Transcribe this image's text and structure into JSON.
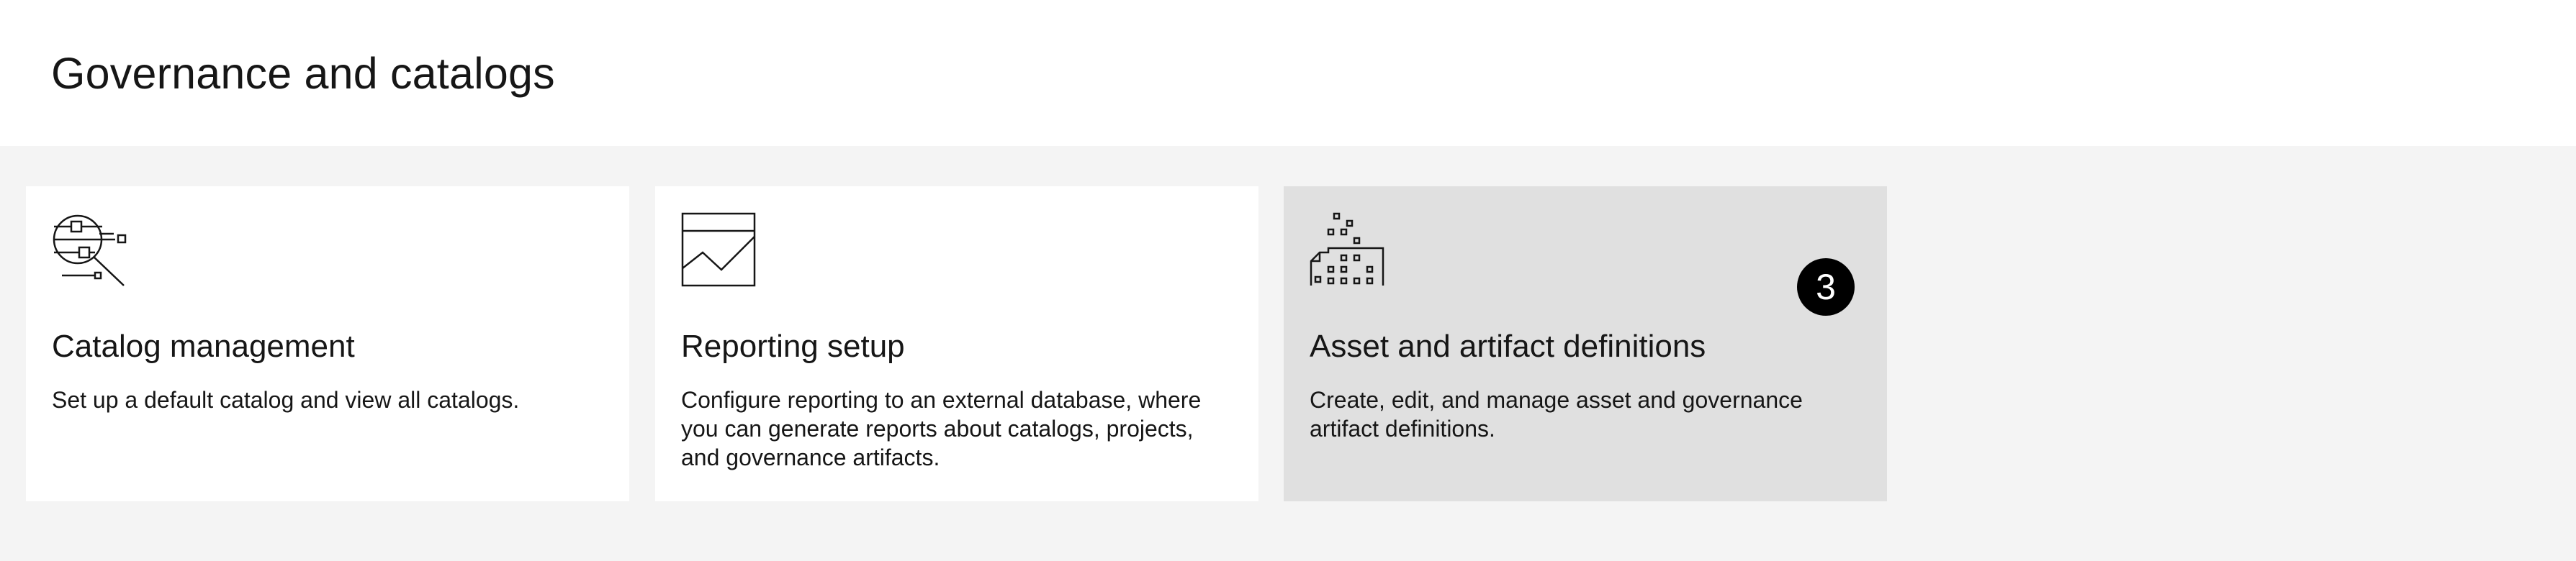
{
  "page": {
    "title": "Governance and catalogs"
  },
  "tiles": [
    {
      "icon": "catalog-search-icon",
      "title": "Catalog management",
      "description": "Set up a default catalog and view all catalogs."
    },
    {
      "icon": "report-chart-icon",
      "title": "Reporting setup",
      "description": "Configure reporting to an external database, where you can generate reports about catalogs, projects, and governance artifacts."
    },
    {
      "icon": "asset-definitions-icon",
      "title": "Asset and artifact definitions",
      "description": "Create, edit, and manage asset and governance artifact definitions.",
      "badge": "3"
    }
  ],
  "colors": {
    "page_background": "#f4f4f4",
    "header_background": "#ffffff",
    "tile_background": "#ffffff",
    "tile_active_background": "#e0e0e0",
    "badge_background": "#000000",
    "text": "#161616"
  }
}
